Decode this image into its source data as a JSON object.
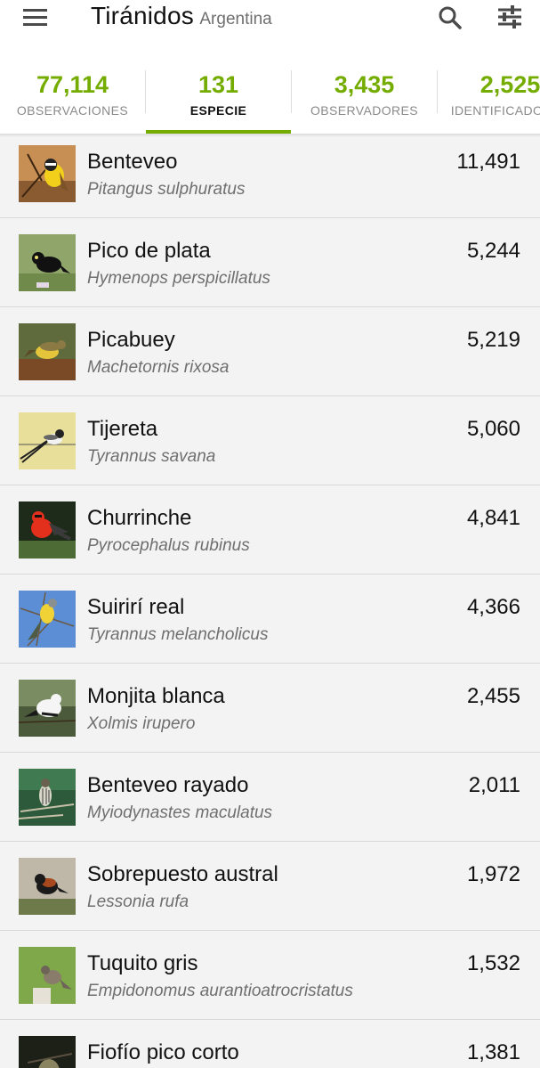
{
  "header": {
    "title": "Tiránidos",
    "subtitle": "Argentina",
    "menu_icon": "hamburger-menu-icon",
    "search_icon": "search-icon",
    "filter_icon": "filter-sliders-icon"
  },
  "tabs": [
    {
      "count": "77,114",
      "label": "OBSERVACIONES",
      "active": false
    },
    {
      "count": "131",
      "label": "ESPECIE",
      "active": true
    },
    {
      "count": "3,435",
      "label": "OBSERVADORES",
      "active": false
    },
    {
      "count": "2,525",
      "label": "IDENTIFICADORES",
      "active": false
    }
  ],
  "colors": {
    "accent": "#74ac00",
    "background": "#f3f3f3",
    "text": "#111111",
    "secondary_text": "#6f6f6f"
  },
  "species": [
    {
      "common": "Benteveo",
      "scientific": "Pitangus sulphuratus",
      "count": "11,491",
      "photo": "yellow-breasted-bird-photo"
    },
    {
      "common": "Pico de plata",
      "scientific": "Hymenops perspicillatus",
      "count": "5,244",
      "photo": "black-bird-photo"
    },
    {
      "common": "Picabuey",
      "scientific": "Machetornis rixosa",
      "count": "5,219",
      "photo": "yellow-bird-on-ground-photo"
    },
    {
      "common": "Tijereta",
      "scientific": "Tyrannus savana",
      "count": "5,060",
      "photo": "fork-tailed-bird-photo"
    },
    {
      "common": "Churrinche",
      "scientific": "Pyrocephalus rubinus",
      "count": "4,841",
      "photo": "red-bird-photo"
    },
    {
      "common": "Suirirí real",
      "scientific": "Tyrannus melancholicus",
      "count": "4,366",
      "photo": "yellow-bird-blue-sky-photo"
    },
    {
      "common": "Monjita blanca",
      "scientific": "Xolmis irupero",
      "count": "2,455",
      "photo": "white-bird-photo"
    },
    {
      "common": "Benteveo rayado",
      "scientific": "Myiodynastes maculatus",
      "count": "2,011",
      "photo": "streaked-bird-photo"
    },
    {
      "common": "Sobrepuesto austral",
      "scientific": "Lessonia rufa",
      "count": "1,972",
      "photo": "rufous-backed-bird-photo"
    },
    {
      "common": "Tuquito gris",
      "scientific": "Empidonomus aurantioatrocristatus",
      "count": "1,532",
      "photo": "grey-bird-photo"
    },
    {
      "common": "Fiofío pico corto",
      "scientific": "",
      "count": "1,381",
      "photo": "dark-bird-photo"
    }
  ]
}
